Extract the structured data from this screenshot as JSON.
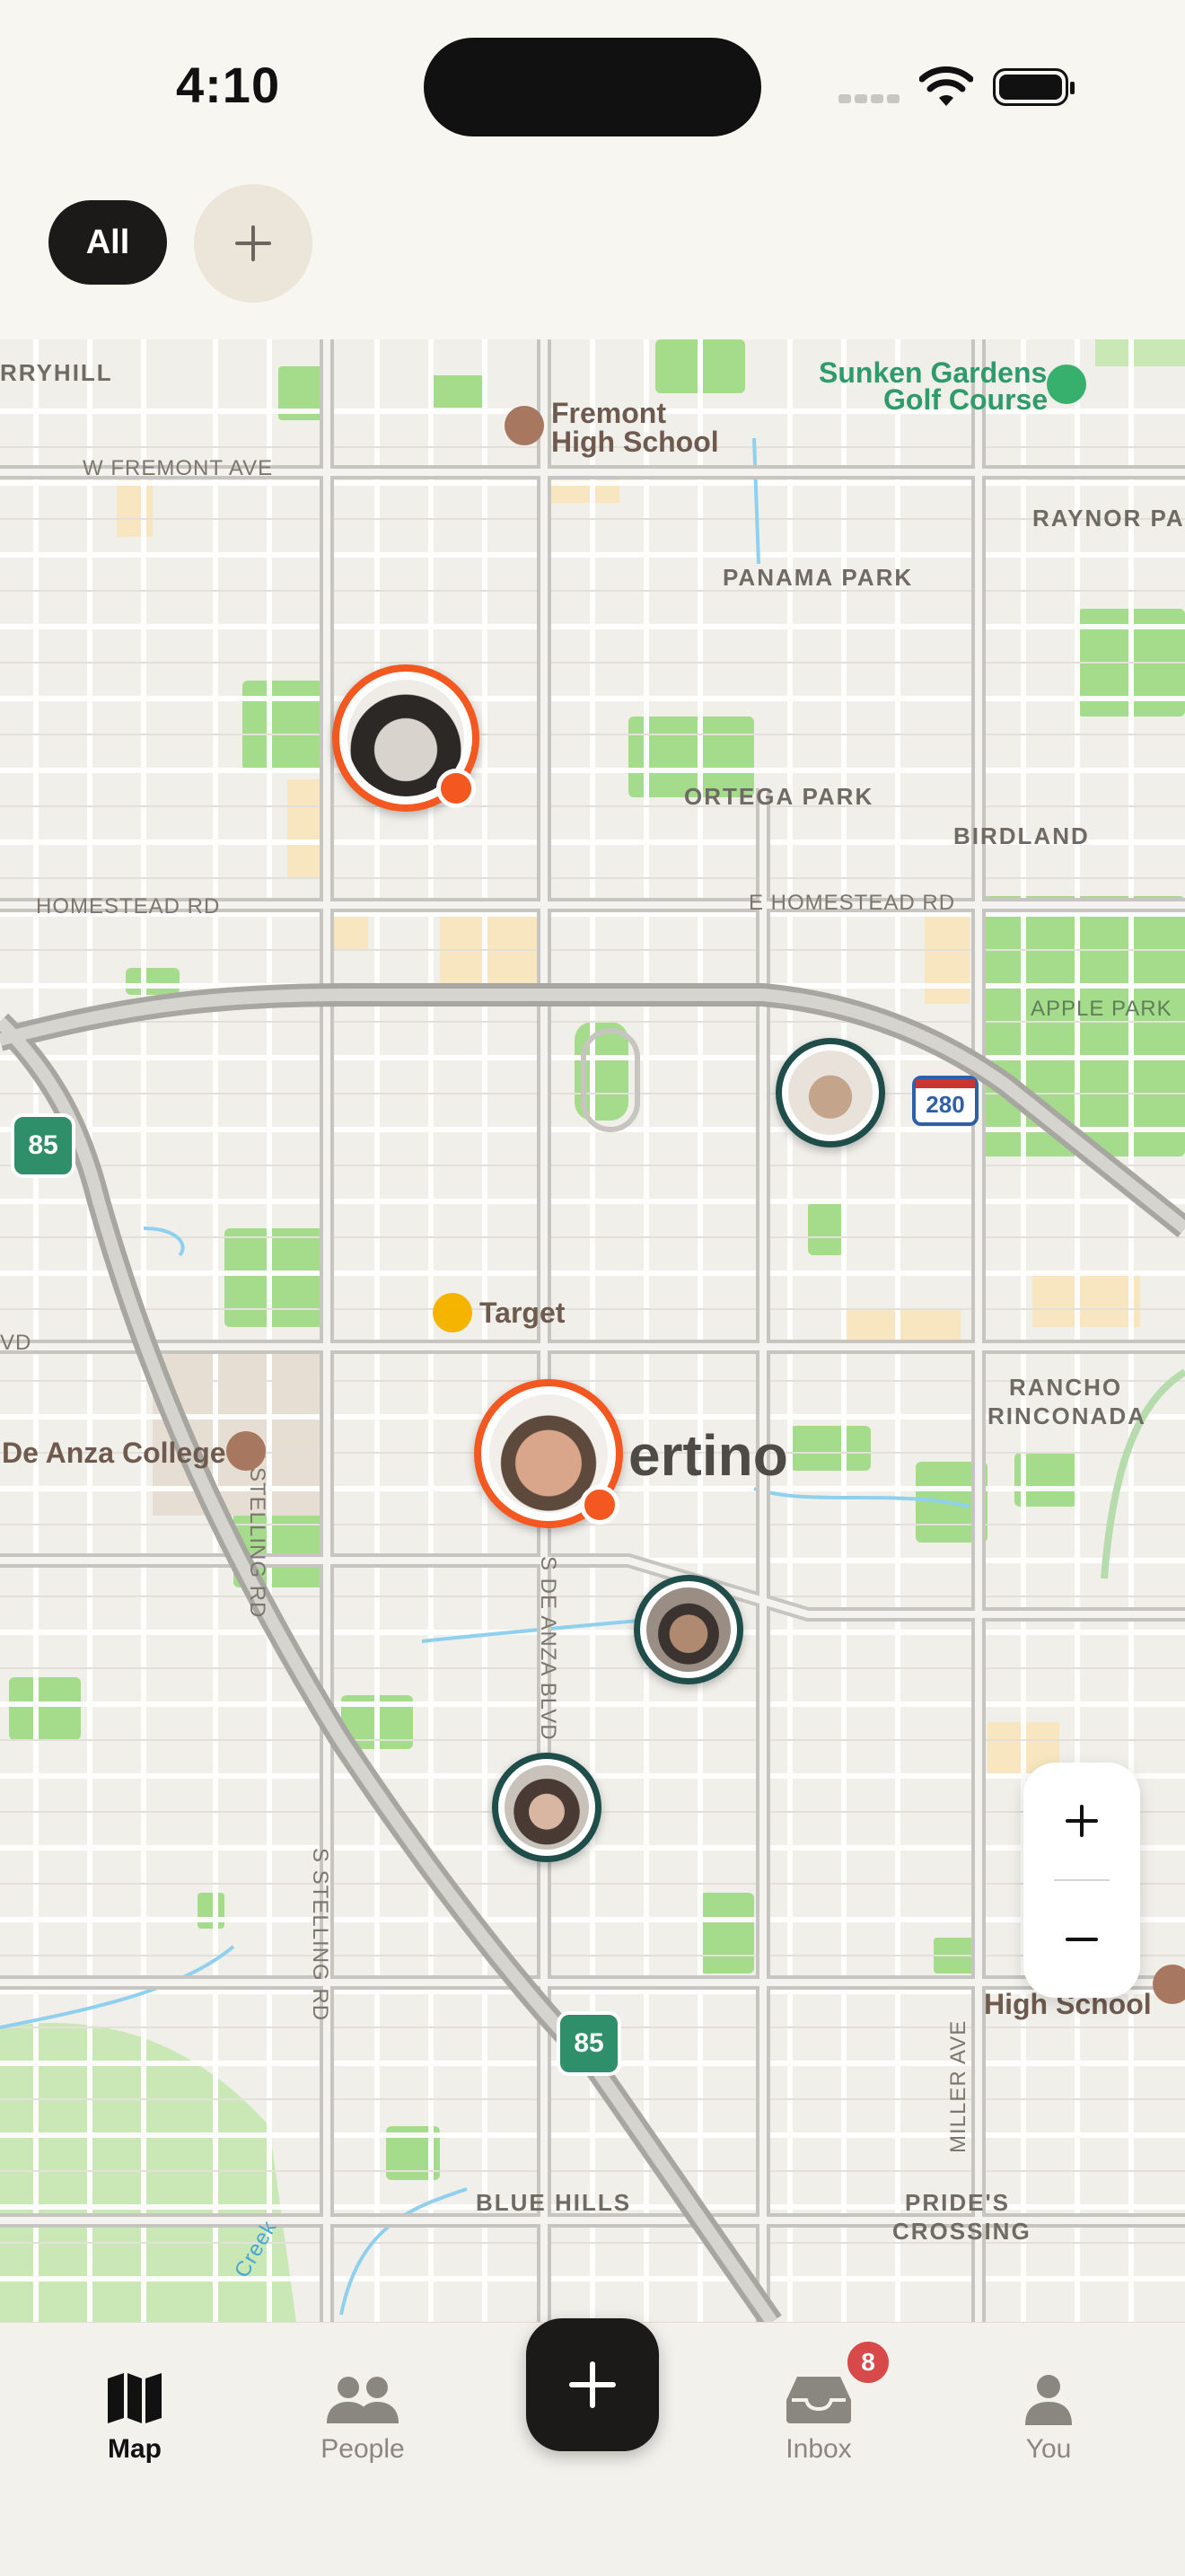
{
  "status_bar": {
    "time": "4:10"
  },
  "filters": {
    "all_label": "All"
  },
  "map": {
    "street_labels": {
      "rryhill": "RRYHILL",
      "w_fremont": "W FREMONT AVE",
      "homestead": "HOMESTEAD RD",
      "e_homestead": "E HOMESTEAD RD",
      "n_stelling": "N STELLING RD",
      "s_stelling": "S STELLING RD",
      "s_de_anza": "S DE ANZA BLVD",
      "miller": "MILLER AVE",
      "vd": "VD"
    },
    "area_labels": {
      "raynor": "RAYNOR PAR",
      "panama": "PANAMA PARK",
      "ortega": "ORTEGA PARK",
      "birdland": "BIRDLAND",
      "apple_park": "APPLE PARK",
      "rancho_1": "RANCHO",
      "rancho_2": "RINCONADA",
      "blue_hills": "BLUE HILLS",
      "prides_1": "PRIDE'S",
      "prides_2": "CROSSING"
    },
    "poi": {
      "fremont_hs_1": "Fremont",
      "fremont_hs_2": "High School",
      "sunken_1": "Sunken Gardens",
      "sunken_2": "Golf Course",
      "target": "Target",
      "de_anza": "De Anza College",
      "high_school_2": "High School",
      "creek": "Creek"
    },
    "city_label": "ertino",
    "highways": {
      "i280": "280",
      "sr85_a": "85",
      "sr85_b": "85"
    }
  },
  "tabs": [
    {
      "label": "Map",
      "icon": "map-icon",
      "active": true
    },
    {
      "label": "People",
      "icon": "people-icon",
      "active": false
    },
    {
      "label": "Inbox",
      "icon": "inbox-icon",
      "active": false,
      "badge": "8"
    },
    {
      "label": "You",
      "icon": "person-icon",
      "active": false
    }
  ],
  "colors": {
    "accent": "#f2581f",
    "ring_teal": "#1f4e4a",
    "dark": "#1b1a18"
  }
}
